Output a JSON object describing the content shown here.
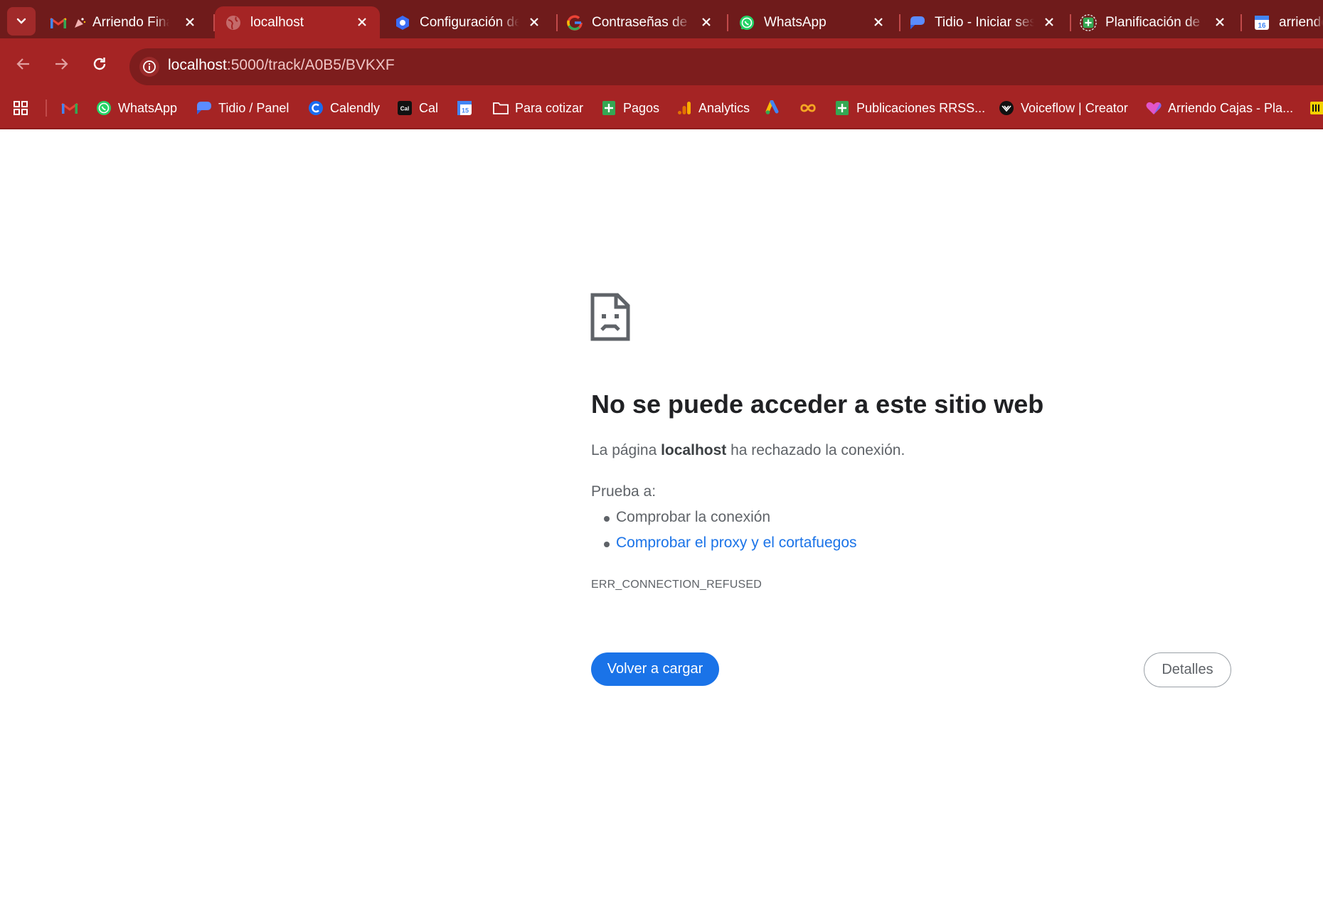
{
  "browser": {
    "tabs": [
      {
        "title": "Arriendo Fina",
        "icon": "gmail-icon"
      },
      {
        "title": "localhost",
        "icon": "globe-icon",
        "active": true
      },
      {
        "title": "Configuración de",
        "icon": "tidio-config-icon"
      },
      {
        "title": "Contraseñas de a",
        "icon": "google-icon"
      },
      {
        "title": "WhatsApp",
        "icon": "whatsapp-icon"
      },
      {
        "title": "Tidio - Iniciar ses",
        "icon": "tidio-icon"
      },
      {
        "title": "Planificación de C",
        "icon": "planner-icon"
      },
      {
        "title": "arriendo",
        "icon": "calendar-icon"
      }
    ],
    "url_host": "localhost",
    "url_rest": ":5000/track/A0B5/BVKXF",
    "bookmarks": [
      {
        "label": "",
        "icon": "gmail-icon"
      },
      {
        "label": "WhatsApp",
        "icon": "whatsapp-icon"
      },
      {
        "label": "Tidio / Panel",
        "icon": "tidio-icon"
      },
      {
        "label": "Calendly",
        "icon": "calendly-icon"
      },
      {
        "label": "Cal",
        "icon": "cal-icon",
        "icon_text": "Cal"
      },
      {
        "label": "",
        "icon": "google-calendar-icon",
        "icon_text": "15"
      },
      {
        "label": "Para cotizar",
        "icon": "folder-icon"
      },
      {
        "label": "Pagos",
        "icon": "sheets-icon"
      },
      {
        "label": "Analytics",
        "icon": "analytics-icon"
      },
      {
        "label": "",
        "icon": "google-ads-icon"
      },
      {
        "label": "",
        "icon": "infinity-icon"
      },
      {
        "label": "Publicaciones RRSS...",
        "icon": "sheets-icon"
      },
      {
        "label": "Voiceflow | Creator",
        "icon": "voiceflow-icon"
      },
      {
        "label": "Arriendo Cajas - Pla...",
        "icon": "clickup-icon"
      }
    ],
    "colors": {
      "frame": "#6f1b1b",
      "toolbar": "#a52424",
      "omnibox": "#7d1d1d",
      "link": "#1a73e8"
    }
  },
  "error_page": {
    "title": "No se puede acceder a este sitio web",
    "desc_prefix": "La página ",
    "desc_host": "localhost",
    "desc_suffix": " ha rechazado la conexión.",
    "try_label": "Prueba a:",
    "suggestions": [
      "Comprobar la conexión",
      "Comprobar el proxy y el cortafuegos"
    ],
    "error_code": "ERR_CONNECTION_REFUSED",
    "reload_label": "Volver a cargar",
    "details_label": "Detalles"
  }
}
